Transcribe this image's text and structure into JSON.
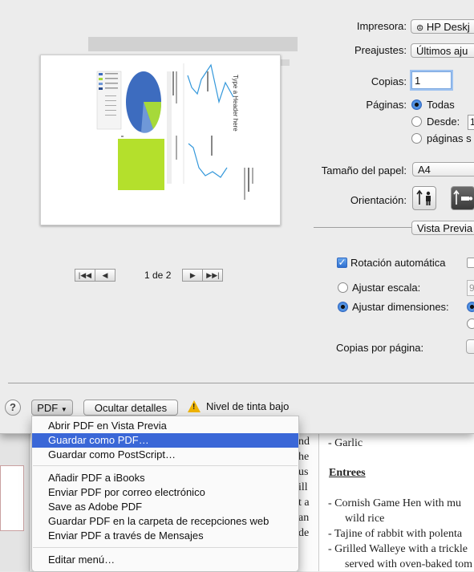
{
  "printer": {
    "label": "Impresora:",
    "value": "HP Deskj",
    "presets_label": "Preajustes:",
    "presets_value": "Últimos aju",
    "copies_label": "Copias:",
    "copies_value": "1",
    "pages_label": "Páginas:",
    "pages_all": "Todas",
    "pages_from": "Desde:",
    "pages_from_value": "1",
    "pages_selection": "páginas s",
    "paper_label": "Tamaño del papel:",
    "paper_value": "A4",
    "orientation_label": "Orientación:",
    "app_popup": "Vista Previa",
    "auto_rotate": "Rotación automática",
    "scale_label": "Ajustar escala:",
    "scale_value": "9",
    "fit_label": "Ajustar dimensiones:",
    "copies_per_page_label": "Copias por página:"
  },
  "preview": {
    "page_indicator": "1 de 2",
    "header_text": "Type a Header here",
    "pie_colors": [
      "#3d6cbf",
      "#6f98d8",
      "#2d4f8e",
      "#a6d93a",
      "#b6d36b"
    ],
    "green_block": "#b4e02c",
    "line_color": "#3498db"
  },
  "toolbar": {
    "help": "?",
    "pdf_button": "PDF",
    "hide_details": "Ocultar detalles",
    "ink_warning": "Nivel de tinta bajo",
    "warn_symbol": "!"
  },
  "pdf_menu": {
    "items": [
      {
        "label": "Abrir PDF en Vista Previa"
      },
      {
        "label": "Guardar como PDF…",
        "highlighted": true
      },
      {
        "label": "Guardar como PostScript…"
      },
      {
        "label": "Añadir PDF a iBooks"
      },
      {
        "label": "Enviar PDF por correo electrónico"
      },
      {
        "label": "Save as Adobe PDF"
      },
      {
        "label": "Guardar PDF en la carpeta de recepciones web"
      },
      {
        "label": "Enviar PDF a través de Mensajes"
      },
      {
        "label": "Editar menú…"
      }
    ]
  },
  "background_doc": {
    "lines": [
      {
        "text": "- Garlic"
      },
      {
        "text": "Entrees",
        "heading": true
      },
      {
        "text": "- Cornish Game Hen with mu"
      },
      {
        "text": "wild rice"
      },
      {
        "text": "- Tajine of rabbit with polenta"
      },
      {
        "text": "- Grilled Walleye with a trickle"
      },
      {
        "text": "served with oven-baked tom"
      }
    ],
    "left_fragments": [
      "nd",
      "he",
      "us",
      "ill",
      "t a",
      "an",
      "de"
    ]
  }
}
